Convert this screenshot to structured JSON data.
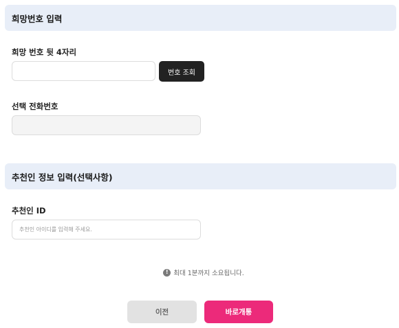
{
  "section_hope": {
    "title": "희망번호 입력",
    "last4_label": "희망 번호 뒷 4자리",
    "last4_value": "",
    "lookup_button": "번호 조회",
    "selected_label": "선택 전화번호",
    "selected_value": ""
  },
  "section_recommender": {
    "title": "추천인 정보 입력(선택사항)",
    "id_label": "추천인 ID",
    "id_placeholder": "추천인 아이디를 입력해 주세요."
  },
  "notice": {
    "icon": "info-icon",
    "icon_glyph": "!",
    "text": "최대 1분까지 소요됩니다."
  },
  "actions": {
    "prev_label": "이전",
    "open_label": "바로개통"
  },
  "colors": {
    "header_bg": "#e8eef8",
    "primary": "#ec2a7a",
    "dark_button": "#222222"
  }
}
